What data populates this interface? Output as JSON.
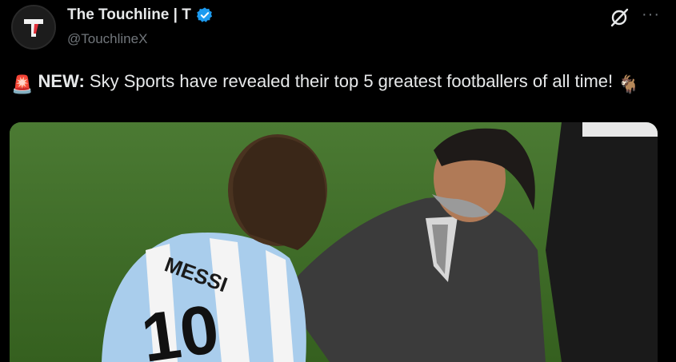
{
  "author": {
    "display_name": "The Touchline | T",
    "handle": "@TouchlineX",
    "verified_icon": "verified-badge-icon"
  },
  "header_actions": {
    "grok_icon": "grok-icon",
    "more_label": "···"
  },
  "tweet": {
    "siren_icon": "🚨",
    "lead": "NEW:",
    "body": " Sky Sports have revealed their top 5 greatest footballers of all time!",
    "goat_icon": "🐐"
  },
  "media": {
    "jersey_name": "MESSI",
    "jersey_number": "10"
  },
  "colors": {
    "background": "#000000",
    "text": "#e7e9ea",
    "muted": "#71767b",
    "verified": "#1d9bf0",
    "pitch": "#3e6b2a"
  }
}
